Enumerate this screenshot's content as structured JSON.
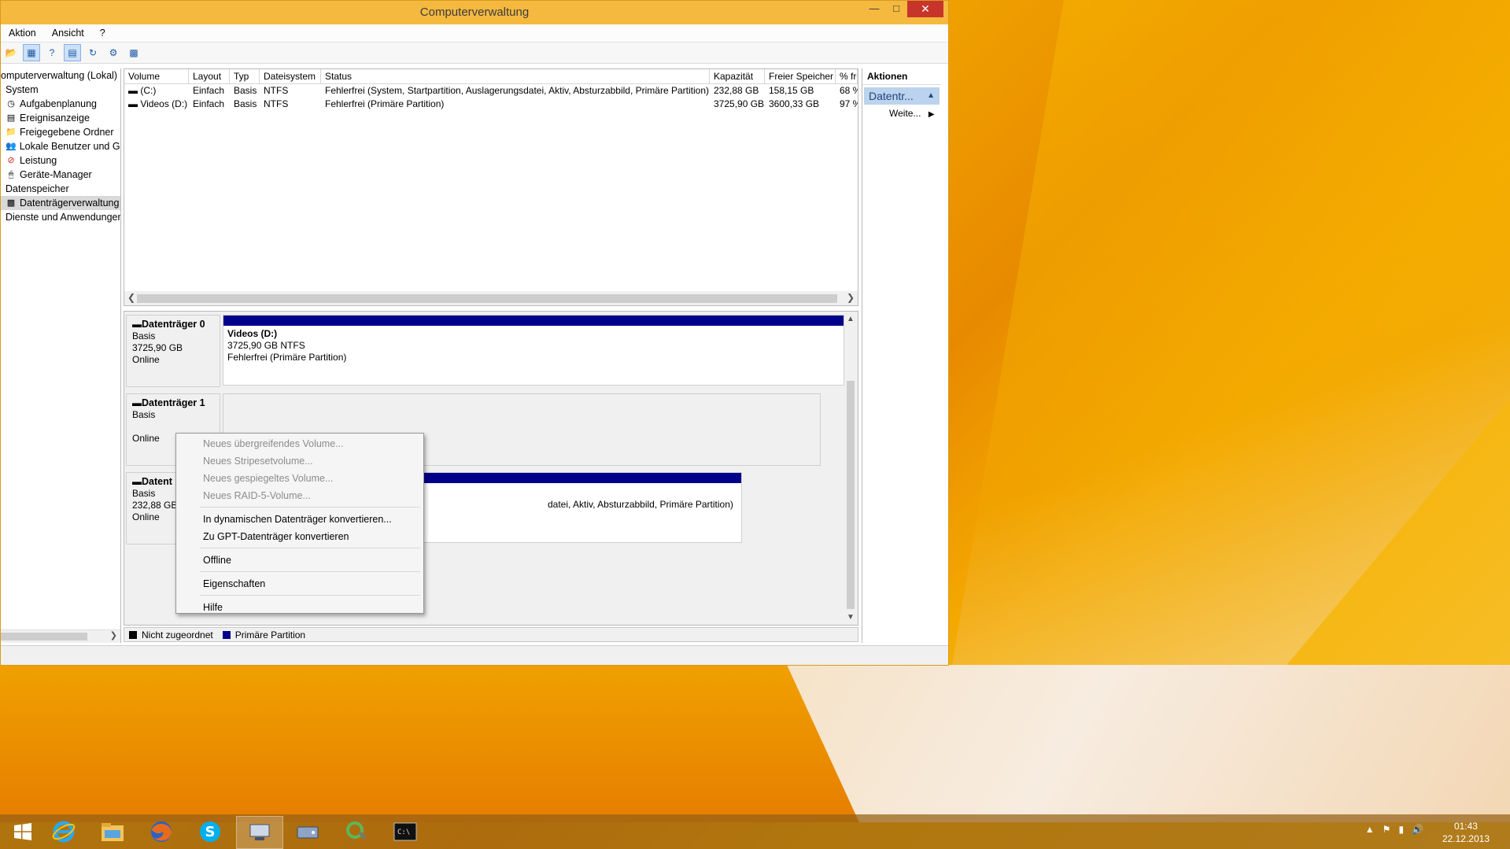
{
  "window": {
    "title": "Computerverwaltung"
  },
  "menu": [
    "Aktion",
    "Ansicht",
    "?"
  ],
  "tree": [
    "omputerverwaltung (Lokal)",
    "System",
    "Aufgabenplanung",
    "Ereignisanzeige",
    "Freigegebene Ordner",
    "Lokale Benutzer und Gr",
    "Leistung",
    "Geräte-Manager",
    "Datenspeicher",
    "Datenträgerverwaltung",
    "Dienste und Anwendungen"
  ],
  "volumes": {
    "columns": [
      "Volume",
      "Layout",
      "Typ",
      "Dateisystem",
      "Status",
      "Kapazität",
      "Freier Speicher",
      "% fre"
    ],
    "rows": [
      [
        "(C:)",
        "Einfach",
        "Basis",
        "NTFS",
        "Fehlerfrei (System, Startpartition, Auslagerungsdatei, Aktiv, Absturzabbild, Primäre Partition)",
        "232,88 GB",
        "158,15 GB",
        "68 %"
      ],
      [
        "Videos (D:)",
        "Einfach",
        "Basis",
        "NTFS",
        "Fehlerfrei (Primäre Partition)",
        "3725,90 GB",
        "3600,33 GB",
        "97 %"
      ]
    ]
  },
  "disks": {
    "d0": {
      "name": "Datenträger 0",
      "type": "Basis",
      "size": "3725,90 GB",
      "state": "Online",
      "part_name": "Videos  (D:)",
      "part_size": "3725,90 GB NTFS",
      "part_status": "Fehlerfrei (Primäre Partition)"
    },
    "d1": {
      "name": "Datenträger 1",
      "type": "Basis",
      "state": "Online"
    },
    "d2": {
      "name": "Datent",
      "type": "Basis",
      "size": "232,88 GB",
      "state": "Online",
      "part_status": "datei, Aktiv, Absturzabbild, Primäre Partition)"
    }
  },
  "legend": {
    "unallocated": "Nicht zugeordnet",
    "primary": "Primäre Partition"
  },
  "actions": {
    "header": "Aktionen",
    "selected": "Datentr...",
    "more": "Weite..."
  },
  "context_menu": {
    "items": [
      {
        "label": "Neues übergreifendes Volume...",
        "disabled": true
      },
      {
        "label": "Neues Stripesetvolume...",
        "disabled": true
      },
      {
        "label": "Neues gespiegeltes Volume...",
        "disabled": true
      },
      {
        "label": "Neues RAID-5-Volume...",
        "disabled": true
      },
      {
        "label": "In dynamischen Datenträger konvertieren...",
        "disabled": false
      },
      {
        "label": "Zu GPT-Datenträger konvertieren",
        "disabled": false
      },
      {
        "label": "Offline",
        "disabled": false
      },
      {
        "label": "Eigenschaften",
        "disabled": false
      },
      {
        "label": "Hilfe",
        "disabled": false
      }
    ]
  },
  "taskbar": {
    "time": "01:43",
    "date": "22.12.2013"
  },
  "colors": {
    "primary_partition": "#00008b",
    "unallocated": "#000000",
    "titlebar": "#f5b940",
    "close": "#c7352a"
  }
}
